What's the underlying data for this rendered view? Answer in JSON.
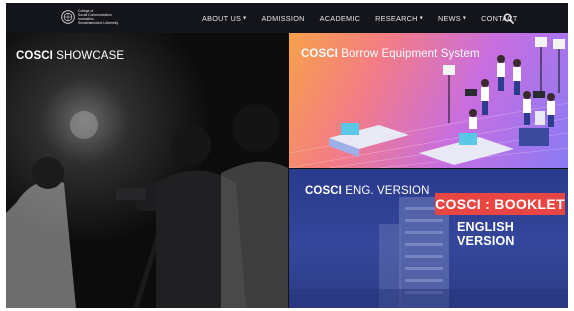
{
  "nav": {
    "logo_lines": [
      "College of",
      "Social Communication",
      "Innovation",
      "Srinakharinwirot University"
    ],
    "items": [
      {
        "label": "ABOUT US",
        "dropdown": true
      },
      {
        "label": "ADMISSION",
        "dropdown": false
      },
      {
        "label": "ACADEMIC",
        "dropdown": false
      },
      {
        "label": "RESEARCH",
        "dropdown": true
      },
      {
        "label": "NEWS",
        "dropdown": true
      },
      {
        "label": "CONTACT",
        "dropdown": false
      }
    ],
    "search_icon": "search-icon"
  },
  "tiles": {
    "showcase": {
      "brand": "COSCI",
      "rest": " SHOWCASE"
    },
    "borrow": {
      "brand": "COSCI",
      "rest": " Borrow Equipment System",
      "brand_color": "#ffffff"
    },
    "eng": {
      "brand": "COSCI",
      "rest": " ENG. VERSION",
      "booklet_title": "COSCI : BOOKLET",
      "booklet_subtitle": "ENGLISH VERSION",
      "booklet_color": "#e94542"
    }
  },
  "colors": {
    "nav_bg": "#14141b",
    "text": "#ffffff",
    "eng_bg": "#2f3f8f"
  }
}
